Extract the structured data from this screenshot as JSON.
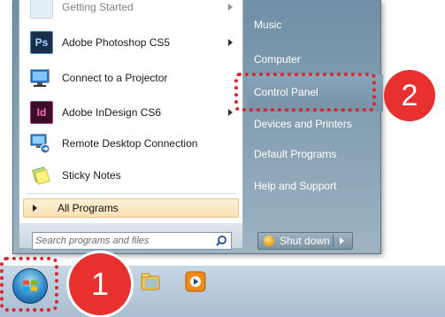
{
  "start_menu": {
    "programs": [
      {
        "id": "getting_started",
        "label": "Getting Started",
        "icon": "getting-started-icon",
        "has_submenu": true
      },
      {
        "id": "photoshop",
        "label": "Adobe Photoshop CS5",
        "icon": "photoshop-icon",
        "icon_text": "Ps",
        "has_submenu": true
      },
      {
        "id": "projector",
        "label": "Connect to a Projector",
        "icon": "projector-icon",
        "has_submenu": false
      },
      {
        "id": "indesign",
        "label": "Adobe InDesign CS6",
        "icon": "indesign-icon",
        "icon_text": "Id",
        "has_submenu": true
      },
      {
        "id": "rdc",
        "label": "Remote Desktop Connection",
        "icon": "remote-desktop-icon",
        "has_submenu": false
      },
      {
        "id": "sticky",
        "label": "Sticky Notes",
        "icon": "sticky-notes-icon",
        "has_submenu": false
      }
    ],
    "all_programs_label": "All Programs",
    "search": {
      "placeholder": "Search programs and files",
      "value": ""
    },
    "right_links": {
      "music": "Music",
      "computer": "Computer",
      "control_panel": "Control Panel",
      "devices": "Devices and Printers",
      "default_programs": "Default Programs",
      "help": "Help and Support"
    },
    "shutdown_label": "Shut down"
  },
  "callouts": {
    "one": "1",
    "two": "2"
  },
  "colors": {
    "callout_red": "#e8312f",
    "photoshop_blue": "#1b2f4a",
    "indesign_magenta": "#8f1f5f"
  }
}
